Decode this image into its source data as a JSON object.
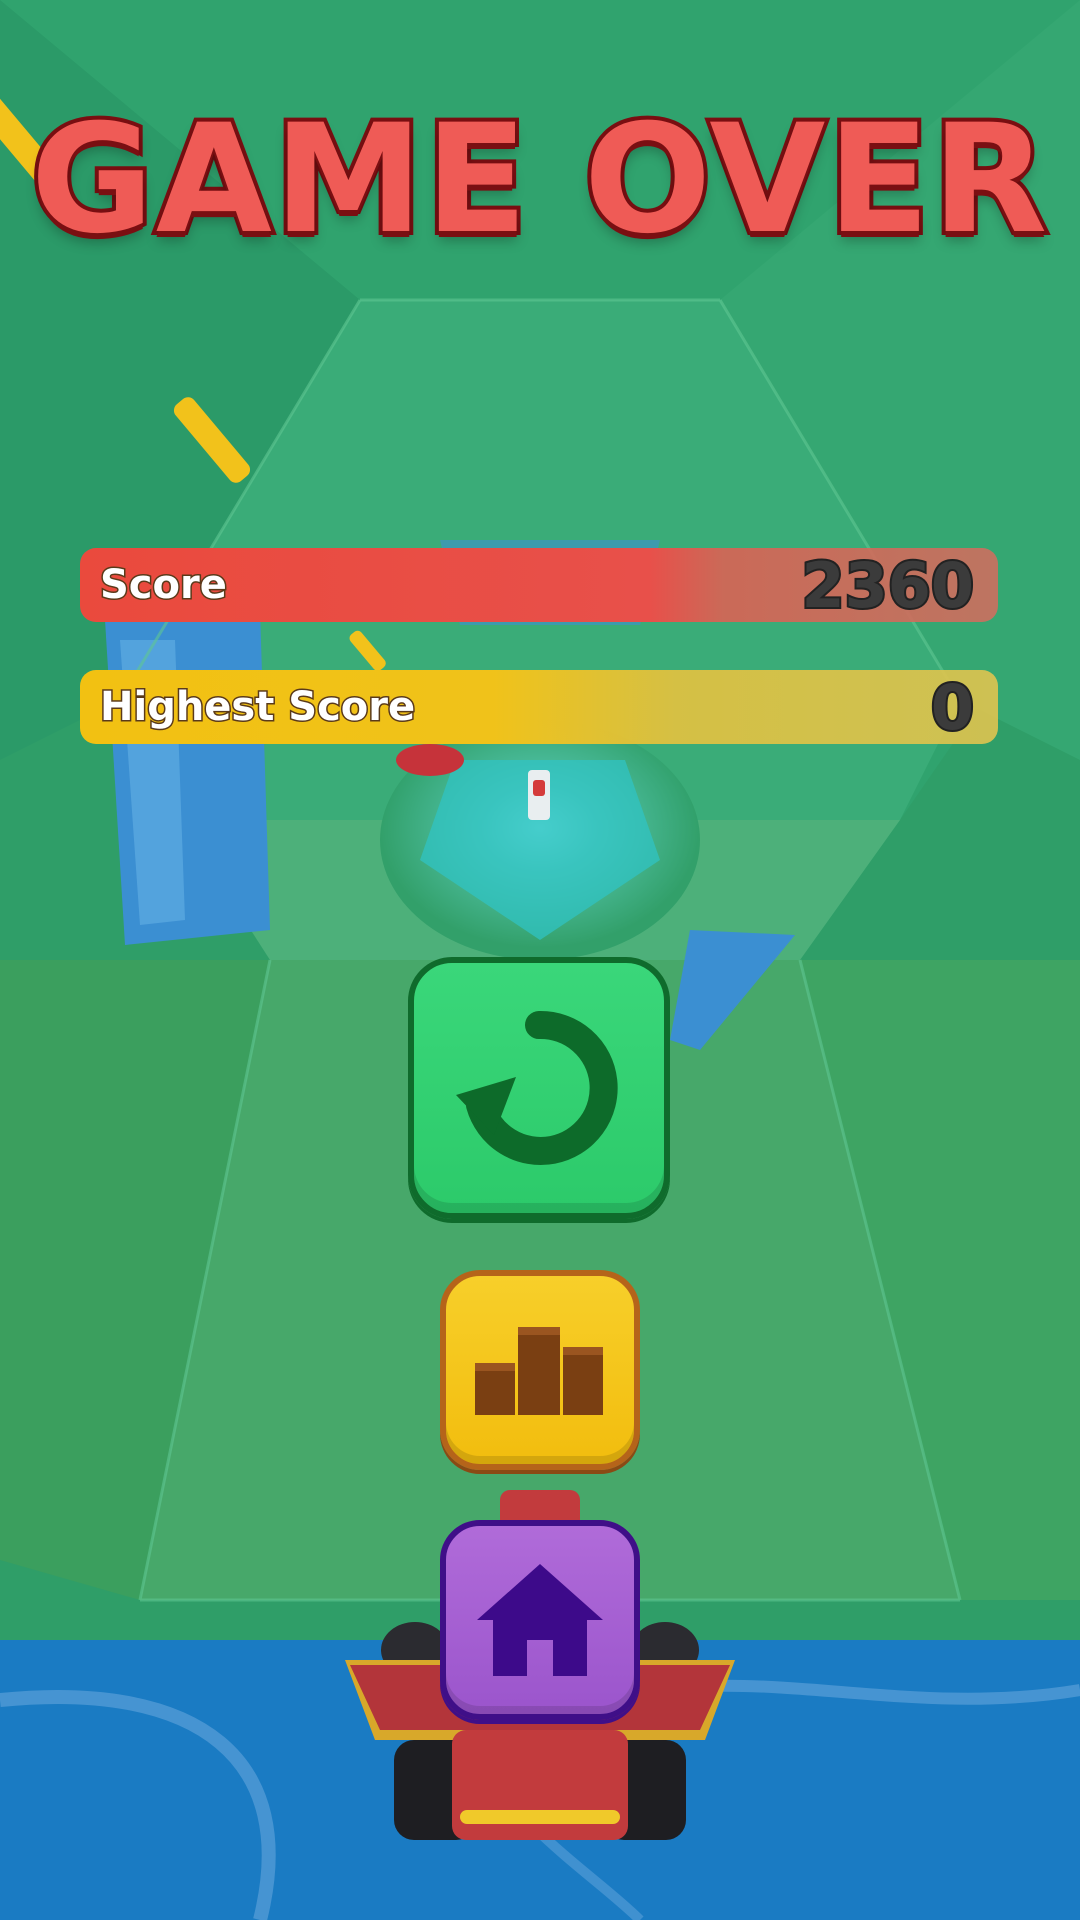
{
  "game_over": {
    "title": "GAME OVER"
  },
  "scores": {
    "score_label": "Score",
    "score_value": "2360",
    "highest_label": "Highest Score",
    "highest_value": "0"
  },
  "buttons": {
    "restart_icon": "restart-arrow-icon",
    "leaderboard_icon": "podium-icon",
    "home_icon": "home-icon"
  },
  "colors": {
    "title_fill": "#ef5b56",
    "score_bar": "#ea4a3d",
    "highest_bar": "#f2c112",
    "restart_button": "#2cca6a",
    "leaderboard_button": "#f2bd0e",
    "home_button": "#9b55cc"
  }
}
